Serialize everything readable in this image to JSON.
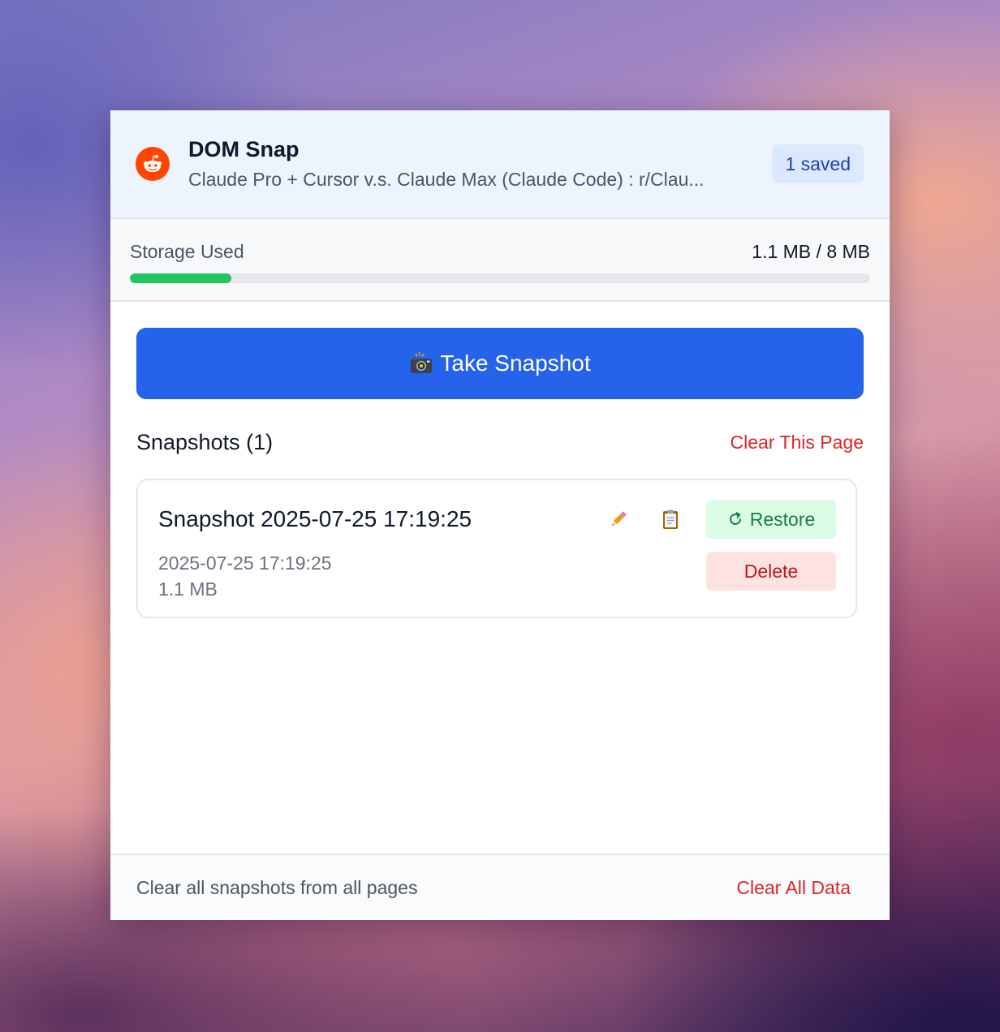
{
  "header": {
    "app_title": "DOM Snap",
    "page_title": "Claude Pro + Cursor v.s. Claude Max (Claude Code) : r/Clau...",
    "saved_badge": "1 saved",
    "site_icon": "reddit-icon",
    "background_color": "#eef4fe"
  },
  "storage": {
    "label": "Storage Used",
    "value": "1.1 MB / 8 MB",
    "used_fraction": 0.1375,
    "bar_color": "#22c55e"
  },
  "main": {
    "take_snapshot_label": "Take Snapshot",
    "take_snapshot_icon": "camera-flash-icon",
    "button_color": "#2563eb",
    "list_title": "Snapshots (1)",
    "clear_page_label": "Clear This Page",
    "snapshots": [
      {
        "title": "Snapshot 2025-07-25 17:19:25",
        "date": "2025-07-25 17:19:25",
        "size": "1.1 MB",
        "edit_icon": "pencil-icon",
        "copy_icon": "clipboard-icon",
        "restore_label": "Restore",
        "restore_icon": "refresh-icon",
        "delete_label": "Delete"
      }
    ]
  },
  "footer": {
    "note": "Clear all snapshots from all pages",
    "clear_all_label": "Clear All Data"
  }
}
